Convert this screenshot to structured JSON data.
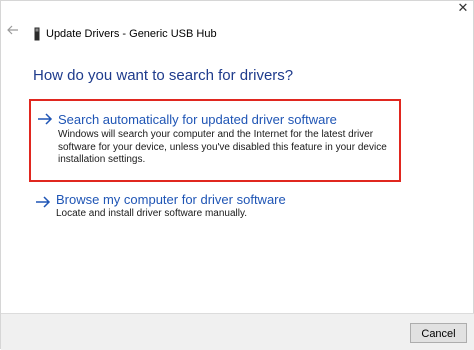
{
  "window": {
    "title": "Update Drivers - Generic USB Hub",
    "close_glyph": "✕",
    "back_icon": "back-arrow-icon",
    "device_icon": "usb-device-icon"
  },
  "heading": "How do you want to search for drivers?",
  "options": [
    {
      "title": "Search automatically for updated driver software",
      "description": "Windows will search your computer and the Internet for the latest driver software for your device, unless you've disabled this feature in your device installation settings.",
      "icon": "arrow-right-icon",
      "highlighted": true
    },
    {
      "title": "Browse my computer for driver software",
      "description": "Locate and install driver software manually.",
      "icon": "arrow-right-icon",
      "highlighted": false
    }
  ],
  "footer": {
    "cancel_label": "Cancel"
  },
  "colors": {
    "heading": "#1e3b8c",
    "link": "#1f55b5",
    "highlight_border": "#e0271f",
    "footer_bg": "#f0f0f0"
  }
}
